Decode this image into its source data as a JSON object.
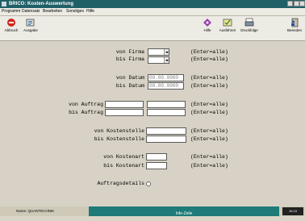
{
  "window": {
    "title": "BRICO: Kosten-Auswertung"
  },
  "menu": [
    "Programm",
    "Datensatz",
    "Bearbeiten",
    "Sonstiges",
    "Hilfe"
  ],
  "toolbar": {
    "left": [
      {
        "label": "Abbruch",
        "icon": "stop-icon"
      },
      {
        "label": "Ausgabe",
        "icon": "output-icon"
      }
    ],
    "right": [
      {
        "label": "Hilfe",
        "icon": "help-icon"
      },
      {
        "label": "Ausführen",
        "icon": "execute-icon"
      },
      {
        "label": "Druckfolge",
        "icon": "print-icon"
      },
      {
        "label": "Beenden",
        "icon": "exit-icon"
      }
    ]
  },
  "form": {
    "von_firma": "von Firma",
    "bis_firma": "bis Firma",
    "von_datum": "von Datum",
    "bis_datum": "bis Datum",
    "datum_value": "00.00.0000",
    "von_auftrag": "von Auftrag",
    "bis_auftrag": "bis Auftrag",
    "von_kostenstelle": "von Kostenstelle",
    "bis_kostenstelle": "bis Kostenstelle",
    "von_kostenart": "von Kostenart",
    "bis_kostenart": "bis Kostenart",
    "auftragsdetails": "Auftragsdetails",
    "hint": "(Enter=alle)"
  },
  "status": {
    "user": "Name: QUANTECHNIK",
    "mid": "Info-Zeile",
    "right": "16.10"
  },
  "colors": {
    "titlebar": "#1f5f66",
    "statusbar": "#1e7b78",
    "content": "#d7d2c5"
  }
}
